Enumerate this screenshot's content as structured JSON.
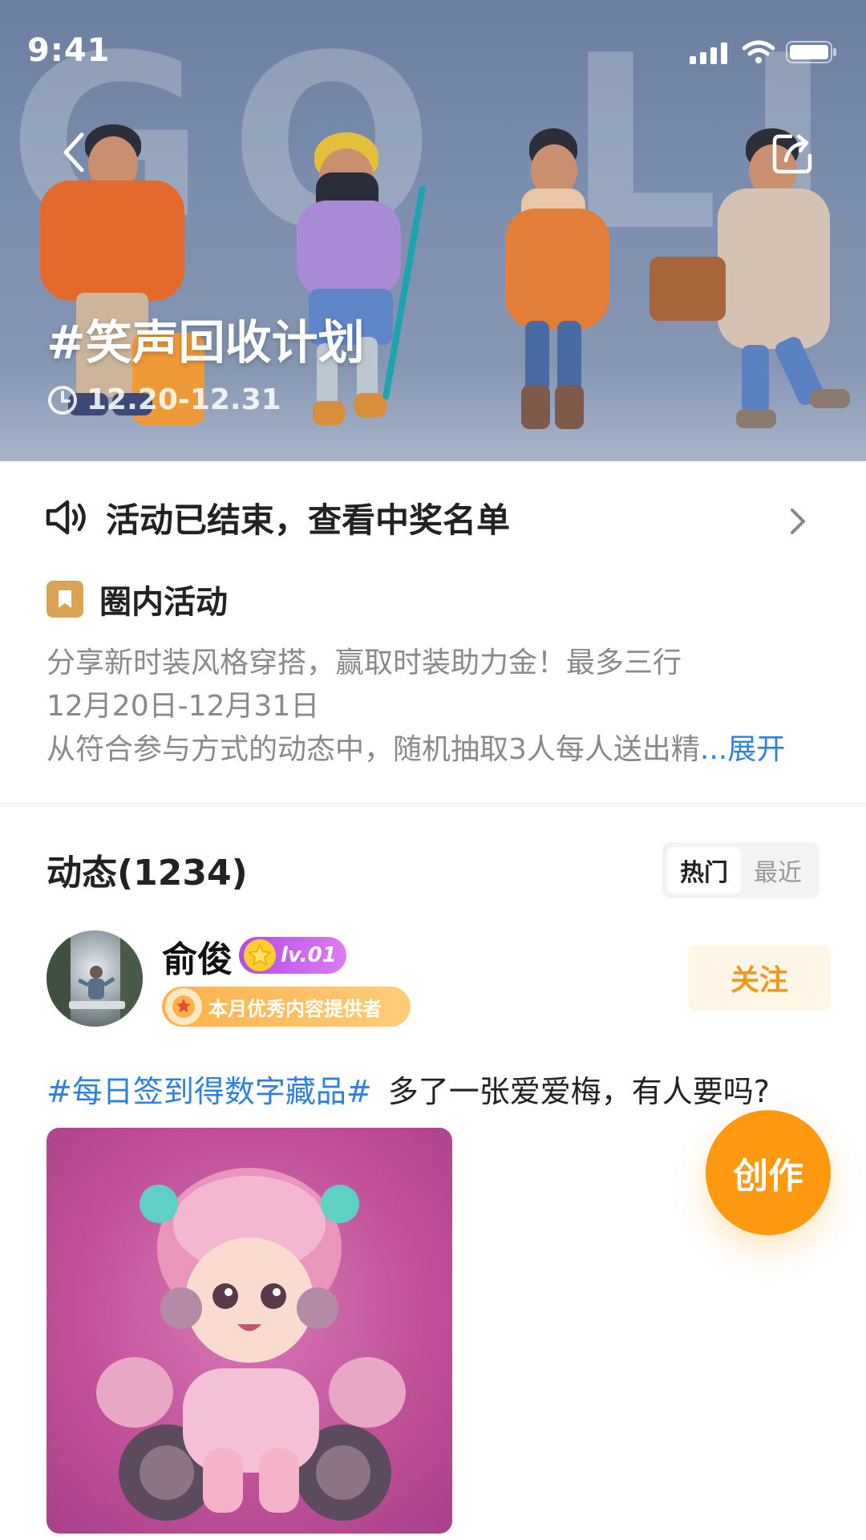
{
  "status_bar": {
    "time": "9:41"
  },
  "hero": {
    "background_text": "GO LIFE IP",
    "title": "#笑声回收计划",
    "date_range": "12.20-12.31"
  },
  "notice": {
    "text": "活动已结束，查看中奖名单"
  },
  "activity": {
    "label": "圈内活动",
    "lines": [
      "分享新时装风格穿搭，赢取时装助力金！最多三行",
      "12月20日-12月31日",
      "从符合参与方式的动态中，随机抽取3人每人送出精"
    ],
    "expand_label": "...展开"
  },
  "feed": {
    "title": "动态(1234)",
    "tabs": [
      {
        "label": "热门",
        "active": true
      },
      {
        "label": "最近",
        "active": false
      }
    ]
  },
  "post": {
    "user_name": "俞俊",
    "level": "lv.01",
    "honor": "本月优秀内容提供者",
    "follow_label": "关注",
    "tag": "#每日签到得数字藏品#",
    "text": "多了一张爱爱梅，有人要吗?"
  },
  "fab": {
    "label": "创作"
  },
  "colors": {
    "accent_orange": "#ff9a10",
    "link_blue": "#2f80e0",
    "activity_badge": "#d9a456",
    "level_purple": "#b24be6"
  }
}
